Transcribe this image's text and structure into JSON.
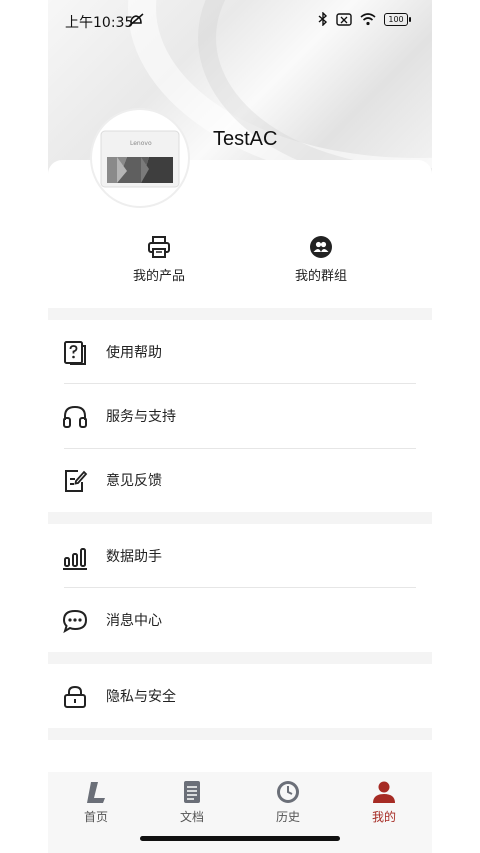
{
  "status": {
    "time": "上午10:35",
    "battery": "100"
  },
  "profile": {
    "username": "TestAC",
    "printer_brand": "Lenovo"
  },
  "quick_actions": [
    {
      "label": "我的产品",
      "icon": "printer-icon"
    },
    {
      "label": "我的群组",
      "icon": "group-icon"
    }
  ],
  "menu": [
    {
      "label": "使用帮助",
      "icon": "help-document-icon"
    },
    {
      "label": "服务与支持",
      "icon": "headset-icon"
    },
    {
      "label": "意见反馈",
      "icon": "feedback-edit-icon"
    },
    {
      "label": "数据助手",
      "icon": "bar-chart-icon"
    },
    {
      "label": "消息中心",
      "icon": "message-icon"
    },
    {
      "label": "隐私与安全",
      "icon": "lock-icon"
    }
  ],
  "tabs": [
    {
      "label": "首页",
      "icon": "home-logo-icon"
    },
    {
      "label": "文档",
      "icon": "document-icon"
    },
    {
      "label": "历史",
      "icon": "clock-icon"
    },
    {
      "label": "我的",
      "icon": "user-icon",
      "active": true
    }
  ],
  "colors": {
    "accent": "#a62b24",
    "icon_gray": "#6b6f78"
  }
}
